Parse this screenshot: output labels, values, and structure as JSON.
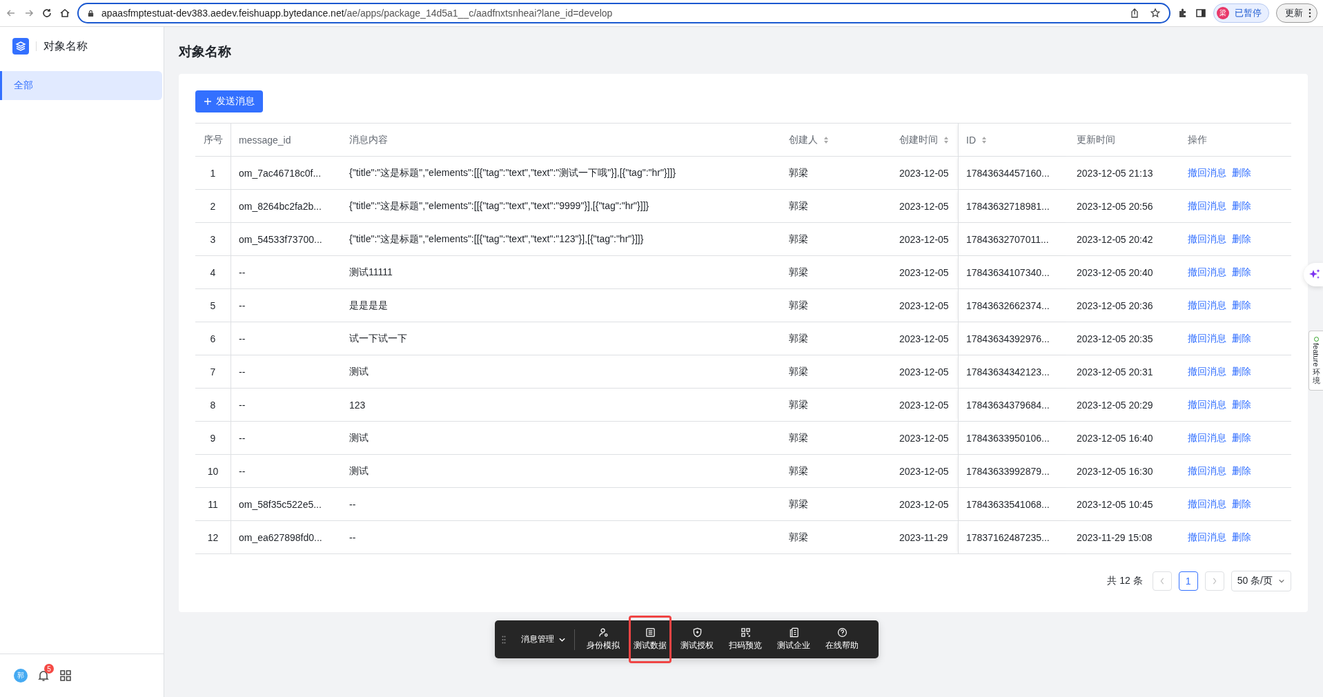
{
  "browser": {
    "url_host": "apaasfmptestuat-dev383.aedev.feishuapp.bytedance.net",
    "url_path": "/ae/apps/package_14d5a1__c/aadfnxtsnheai?lane_id=develop",
    "profile": {
      "avatar": "梁",
      "label": "已暂停"
    },
    "update_button": "更新"
  },
  "sidebar": {
    "app_title": "对象名称",
    "items": [
      {
        "label": "全部",
        "selected": true
      }
    ],
    "footer": {
      "avatar": "郭",
      "notification_count": "5"
    }
  },
  "page": {
    "title": "对象名称",
    "send_button": "发送消息"
  },
  "table": {
    "columns": [
      {
        "label": "序号",
        "sortable": false
      },
      {
        "label": "message_id",
        "sortable": false
      },
      {
        "label": "消息内容",
        "sortable": false
      },
      {
        "label": "创建人",
        "sortable": true
      },
      {
        "label": "创建时间",
        "sortable": true
      },
      {
        "label": "ID",
        "sortable": true
      },
      {
        "label": "更新时间",
        "sortable": false
      },
      {
        "label": "操作",
        "sortable": false
      }
    ],
    "rows": [
      {
        "index": "1",
        "message_id": "om_7ac46718c0f...",
        "content": "{\"title\":\"这是标题\",\"elements\":[[{\"tag\":\"text\",\"text\":\"测试一下哦\"}],[{\"tag\":\"hr\"}]]}",
        "creator": "郭梁",
        "created": "2023-12-05",
        "id": "17843634457160...",
        "updated": "2023-12-05 21:13",
        "actions": [
          "撤回消息",
          "删除"
        ]
      },
      {
        "index": "2",
        "message_id": "om_8264bc2fa2b...",
        "content": "{\"title\":\"这是标题\",\"elements\":[[{\"tag\":\"text\",\"text\":\"9999\"}],[{\"tag\":\"hr\"}]]}",
        "creator": "郭梁",
        "created": "2023-12-05",
        "id": "17843632718981...",
        "updated": "2023-12-05 20:56",
        "actions": [
          "撤回消息",
          "删除"
        ]
      },
      {
        "index": "3",
        "message_id": "om_54533f73700...",
        "content": "{\"title\":\"这是标题\",\"elements\":[[{\"tag\":\"text\",\"text\":\"123\"}],[{\"tag\":\"hr\"}]]}",
        "creator": "郭梁",
        "created": "2023-12-05",
        "id": "17843632707011...",
        "updated": "2023-12-05 20:42",
        "actions": [
          "撤回消息",
          "删除"
        ]
      },
      {
        "index": "4",
        "message_id": "--",
        "content": "测试11111",
        "creator": "郭梁",
        "created": "2023-12-05",
        "id": "17843634107340...",
        "updated": "2023-12-05 20:40",
        "actions": [
          "撤回消息",
          "删除"
        ]
      },
      {
        "index": "5",
        "message_id": "--",
        "content": "是是是是",
        "creator": "郭梁",
        "created": "2023-12-05",
        "id": "17843632662374...",
        "updated": "2023-12-05 20:36",
        "actions": [
          "撤回消息",
          "删除"
        ]
      },
      {
        "index": "6",
        "message_id": "--",
        "content": "试一下试一下",
        "creator": "郭梁",
        "created": "2023-12-05",
        "id": "17843634392976...",
        "updated": "2023-12-05 20:35",
        "actions": [
          "撤回消息",
          "删除"
        ]
      },
      {
        "index": "7",
        "message_id": "--",
        "content": "测试",
        "creator": "郭梁",
        "created": "2023-12-05",
        "id": "17843634342123...",
        "updated": "2023-12-05 20:31",
        "actions": [
          "撤回消息",
          "删除"
        ]
      },
      {
        "index": "8",
        "message_id": "--",
        "content": "123",
        "creator": "郭梁",
        "created": "2023-12-05",
        "id": "17843634379684...",
        "updated": "2023-12-05 20:29",
        "actions": [
          "撤回消息",
          "删除"
        ]
      },
      {
        "index": "9",
        "message_id": "--",
        "content": "测试",
        "creator": "郭梁",
        "created": "2023-12-05",
        "id": "17843633950106...",
        "updated": "2023-12-05 16:40",
        "actions": [
          "撤回消息",
          "删除"
        ]
      },
      {
        "index": "10",
        "message_id": "--",
        "content": "测试",
        "creator": "郭梁",
        "created": "2023-12-05",
        "id": "17843633992879...",
        "updated": "2023-12-05 16:30",
        "actions": [
          "撤回消息",
          "删除"
        ]
      },
      {
        "index": "11",
        "message_id": "om_58f35c522e5...",
        "content": "--",
        "creator": "郭梁",
        "created": "2023-12-05",
        "id": "17843633541068...",
        "updated": "2023-12-05 10:45",
        "actions": [
          "撤回消息",
          "删除"
        ]
      },
      {
        "index": "12",
        "message_id": "om_ea627898fd0...",
        "content": "--",
        "creator": "郭梁",
        "created": "2023-11-29",
        "id": "17837162487235...",
        "updated": "2023-11-29 15:08",
        "actions": [
          "撤回消息",
          "删除"
        ]
      }
    ]
  },
  "pagination": {
    "total": "共 12 条",
    "pages": [
      {
        "label": "1",
        "selected": true
      }
    ],
    "page_size": "50 条/页"
  },
  "toolbar": {
    "menu": "消息管理",
    "items": [
      {
        "label": "身份模拟",
        "kind": "user",
        "highlighted": false
      },
      {
        "label": "测试数据",
        "kind": "table",
        "highlighted": true
      },
      {
        "label": "测试授权",
        "kind": "shield",
        "highlighted": false
      },
      {
        "label": "扫码预览",
        "kind": "qr",
        "highlighted": false
      },
      {
        "label": "测试企业",
        "kind": "doc",
        "highlighted": false
      },
      {
        "label": "在线帮助",
        "kind": "help",
        "highlighted": false
      }
    ]
  },
  "env_tag": {
    "label": "feature",
    "suffix": "环境"
  }
}
